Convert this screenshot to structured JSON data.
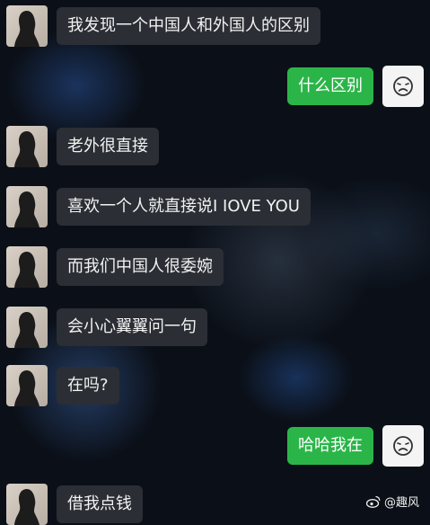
{
  "messages": [
    {
      "side": "left",
      "text": "我发现一个中国人和外国人的区别"
    },
    {
      "side": "right",
      "text": "什么区别"
    },
    {
      "side": "left",
      "text": "老外很直接"
    },
    {
      "side": "left",
      "text": "喜欢一个人就直接说I IOVE YOU"
    },
    {
      "side": "left",
      "text": "而我们中国人很委婉"
    },
    {
      "side": "left",
      "text": "会小心翼翼问一句"
    },
    {
      "side": "left",
      "text": "在吗?"
    },
    {
      "side": "right",
      "text": "哈哈我在"
    },
    {
      "side": "left",
      "text": "借我点钱"
    }
  ],
  "watermark": {
    "text": "@趣风",
    "icon": "weibo-icon"
  },
  "colors": {
    "outgoing_bubble": "#2bb549",
    "incoming_bubble": "#2b2e34",
    "background": "#0b1018"
  }
}
